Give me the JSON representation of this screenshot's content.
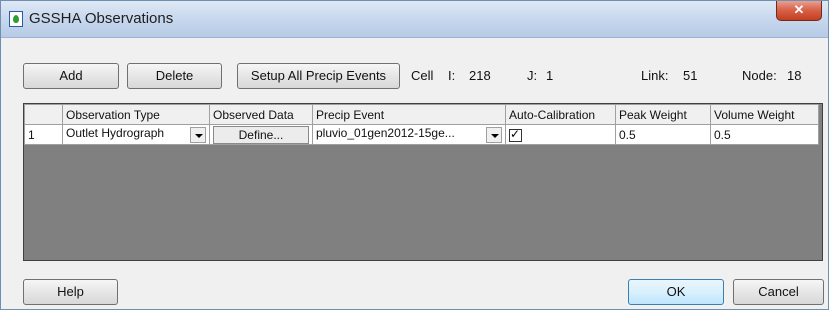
{
  "window": {
    "title": "GSSHA Observations",
    "close_glyph": "✕"
  },
  "toolbar": {
    "add_label": "Add",
    "delete_label": "Delete",
    "setup_label": "Setup All Precip Events"
  },
  "info": {
    "cell_label": "Cell",
    "i_label": "I:",
    "i_value": "218",
    "j_label": "J:",
    "j_value": "1",
    "link_label": "Link:",
    "link_value": "51",
    "node_label": "Node:",
    "node_value": "18"
  },
  "table": {
    "columns": [
      "Observation Type",
      "Observed Data",
      "Precip Event",
      "Auto-Calibration",
      "Peak Weight",
      "Volume Weight"
    ],
    "rows": [
      {
        "index": "1",
        "observation_type": "Outlet Hydrograph",
        "observed_data_button": "Define...",
        "precip_event": "pluvio_01gen2012-15ge...",
        "auto_calibration": true,
        "auto_calibration_mark": "✓",
        "peak_weight": "0.5",
        "volume_weight": "0.5"
      }
    ]
  },
  "footer": {
    "help_label": "Help",
    "ok_label": "OK",
    "cancel_label": "Cancel"
  },
  "icons": {
    "app": "gssha-app-icon",
    "close": "close-icon",
    "dropdown": "chevron-down-icon",
    "checkbox": "checkbox-checked-icon"
  },
  "colors": {
    "titlebar": "#c9d9ee",
    "close_button": "#c43e1f",
    "grid_background": "#808080",
    "default_button": "#bee6fd"
  }
}
